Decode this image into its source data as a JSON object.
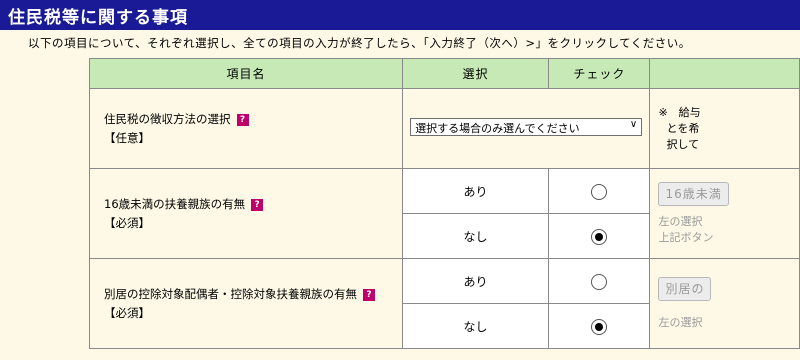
{
  "header": {
    "title": "住民税等に関する事項"
  },
  "instruction": "以下の項目について、それぞれ選択し、全ての項目の入力が終了したら、「入力終了（次へ）>」をクリックしてください。",
  "table": {
    "headers": {
      "item": "項目名",
      "select": "選択",
      "check": "チェック"
    },
    "help_icon": "?",
    "rows": [
      {
        "label": "住民税の徴収方法の選択",
        "requirement": "【任意】",
        "select_value": "選択する場合のみ選んでください",
        "side_note": [
          "※　給与",
          "とを希",
          "択して"
        ]
      },
      {
        "label": "16歳未満の扶養親族の有無",
        "requirement": "【必須】",
        "options": [
          {
            "label": "あり",
            "selected": false
          },
          {
            "label": "なし",
            "selected": true
          }
        ],
        "side_button": "16歳未満",
        "side_muted": [
          "左の選択",
          "上記ボタン"
        ]
      },
      {
        "label": "別居の控除対象配偶者・控除対象扶養親族の有無",
        "requirement": "【必須】",
        "options": [
          {
            "label": "あり",
            "selected": false
          },
          {
            "label": "なし",
            "selected": true
          }
        ],
        "side_button": "別居の",
        "side_muted": [
          "左の選択"
        ]
      }
    ]
  }
}
